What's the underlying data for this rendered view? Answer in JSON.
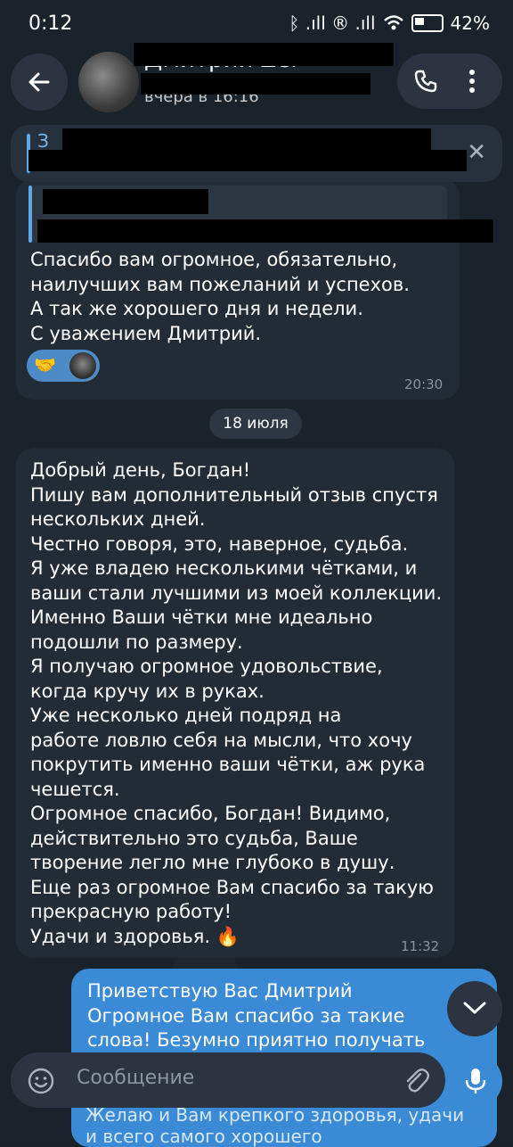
{
  "status_bar": {
    "time": "0:12",
    "indicators": "ᛒ .ıll ® .ıll",
    "battery": "42%"
  },
  "header": {
    "contact_name": "Дмитрий Zer",
    "last_seen": "вчера в 16:16"
  },
  "pinned": {
    "letter": "З"
  },
  "messages": {
    "first": {
      "text": "Спасибо вам огромное, обязательно,\nнаилучших вам пожеланий и успехов.\nА так же хорошего дня и недели.\nС уважением Дмитрий.",
      "reaction_emoji": "🤝",
      "time": "20:30"
    },
    "date_separator": "18 июля",
    "second": {
      "text": "Добрый день, Богдан!\nПишу вам дополнительный отзыв спустя\nнескольких дней.\nЧестно говоря, это, наверное, судьба.\nЯ уже владею несколькими чётками, и\nваши стали лучшими из моей коллекции.\nИменно Ваши чётки мне идеально\nподошли по размеру.\nЯ получаю огромное удовольствие,\nкогда кручу их в руках.\nУже несколько дней подряд на\nработе ловлю себя на мысли, что хочу\nпокрутить именно ваши чётки, аж рука\nчешется.\nОгромное спасибо, Богдан! Видимо,\nдействительно это судьба, Ваше\nтворение легло мне глубоко в душу.\nЕще раз огромное Вам спасибо за такую\nпрекрасную работу!\nУдачи и здоровья. 🔥",
      "time": "11:32"
    },
    "outgoing": {
      "text": "Приветствую Вас Дмитрий\nОгромное Вам спасибо за такие\nслова! Безумно приятно получать",
      "below_text_1": "Желаю и Вам крепкого здоровья, удачи",
      "below_text_2": "и всего самого хорошего"
    }
  },
  "composer": {
    "placeholder": "Сообщение"
  },
  "colors": {
    "background": "#1a232c",
    "incoming_bubble": "#222c36",
    "outgoing_bubble": "#3a8ad6",
    "accent": "#5ea8e8"
  }
}
